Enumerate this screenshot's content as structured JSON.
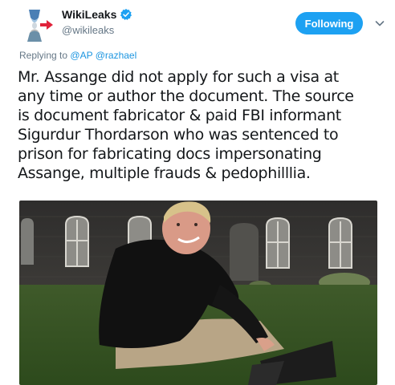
{
  "account": {
    "display_name": "WikiLeaks",
    "handle": "@wikileaks",
    "verified_icon": "verified-badge-icon",
    "avatar_icon": "hourglass-logo-icon"
  },
  "follow_button": {
    "label": "Following",
    "color": "#1da1f2"
  },
  "menu_icon": "chevron-down-icon",
  "reply": {
    "prefix": "Replying to",
    "mentions": [
      "@AP",
      "@razhael"
    ]
  },
  "tweet": {
    "text": "Mr. Assange did not apply for such a visa at\nany time or author the document. The source\nis document fabricator & paid FBI informant\nSigurdur Thordarson who was sentenced to\nprison for fabricating docs impersonating\nAssange, multiple frauds & pedophilllia."
  },
  "media": {
    "type": "photo",
    "description_icon": "tweet-photo"
  },
  "colors": {
    "text": "#14171a",
    "secondary": "#657786",
    "link": "#1b95e0"
  }
}
